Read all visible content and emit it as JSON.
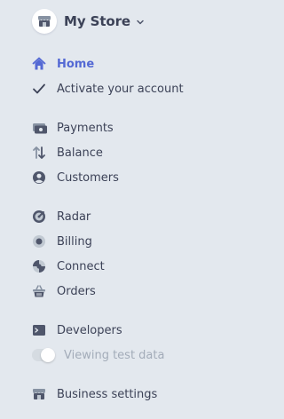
{
  "store": {
    "name": "My Store",
    "icon": "storefront-icon"
  },
  "nav": {
    "home": {
      "label": "Home",
      "icon": "home-icon"
    },
    "activate": {
      "label": "Activate your account",
      "icon": "checkmark-icon"
    },
    "payments": {
      "label": "Payments",
      "icon": "payments-icon"
    },
    "balance": {
      "label": "Balance",
      "icon": "balance-arrows-icon"
    },
    "customers": {
      "label": "Customers",
      "icon": "customer-icon"
    },
    "radar": {
      "label": "Radar",
      "icon": "radar-icon"
    },
    "billing": {
      "label": "Billing",
      "icon": "billing-icon"
    },
    "connect": {
      "label": "Connect",
      "icon": "connect-icon"
    },
    "orders": {
      "label": "Orders",
      "icon": "basket-icon"
    },
    "developers": {
      "label": "Developers",
      "icon": "terminal-icon"
    },
    "test_data": {
      "label": "Viewing test data",
      "toggle_on": false
    },
    "business_settings": {
      "label": "Business settings",
      "icon": "storefront-icon"
    }
  },
  "colors": {
    "background": "#e3e8ee",
    "text": "#3c4257",
    "active": "#5469d4",
    "muted": "#a3acb9",
    "icon": "#4f566b"
  }
}
